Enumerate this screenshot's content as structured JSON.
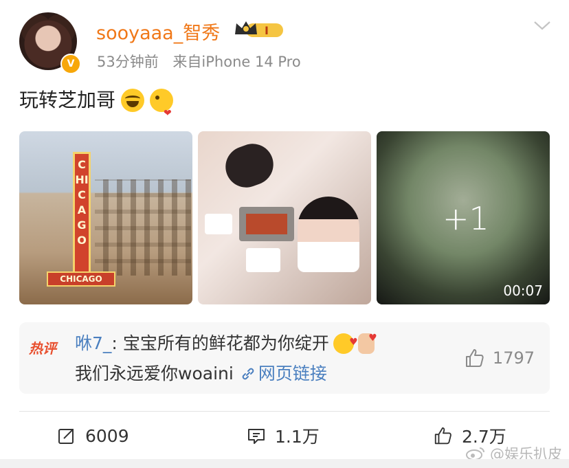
{
  "post": {
    "username": "sooyaaa_智秀",
    "time_ago": "53分钟前",
    "source": "来自iPhone 14 Pro",
    "text": "玩转芝加哥",
    "emoji_names": [
      "grinning-squinting-face",
      "face-blowing-kiss"
    ],
    "verified_badge": "V",
    "crown_level": "I"
  },
  "photos": {
    "sign_text": "CHICAGO",
    "more_count": "+1",
    "video_duration": "00:07"
  },
  "hot_comment": {
    "badge": "热评",
    "user": "咻7_",
    "separator": ":",
    "text_line1": "宝宝所有的鲜花都为你绽开",
    "text_line2": "我们永远爱你woaini",
    "link_label": "网页链接",
    "likes": "1797"
  },
  "actions": {
    "reposts": "6009",
    "comments": "1.1万",
    "likes": "2.7万"
  },
  "watermark": {
    "label": "@娱乐扒皮"
  },
  "colors": {
    "username": "#f07818",
    "link": "#4a7fbf",
    "hot_badge": "#e8502f",
    "meta_text": "#8a8a8a"
  }
}
